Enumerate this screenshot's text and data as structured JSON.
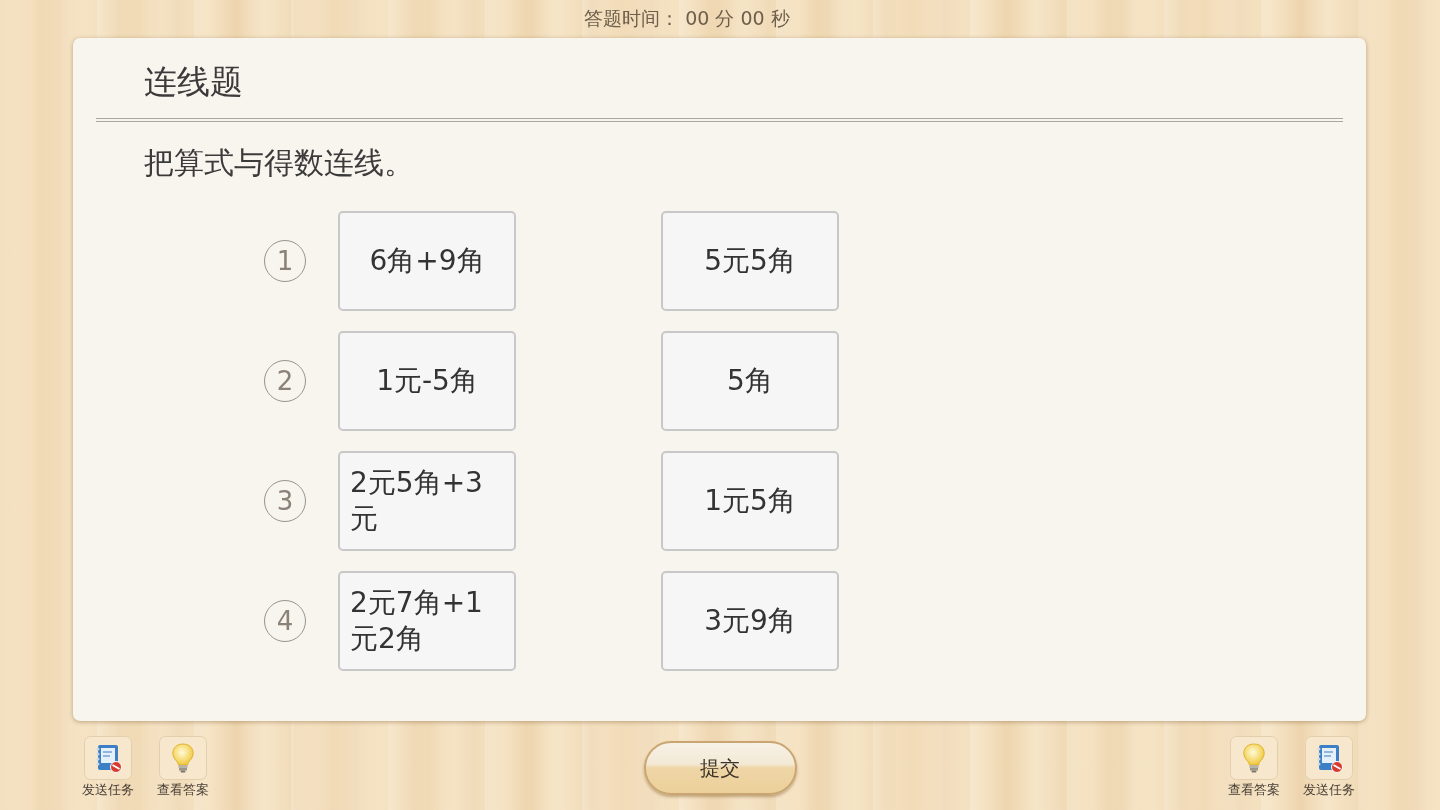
{
  "timer": {
    "text": "答题时间： 00 分 00 秒"
  },
  "question": {
    "type": "连线题",
    "instruction": "把算式与得数连线。",
    "rows": [
      {
        "number": "1",
        "left": "6角+9角",
        "right": "5元5角"
      },
      {
        "number": "2",
        "left": "1元-5角",
        "right": "5角"
      },
      {
        "number": "3",
        "left": "2元5角+3元",
        "right": "1元5角"
      },
      {
        "number": "4",
        "left": "2元7角+1元2角",
        "right": "3元9角"
      }
    ]
  },
  "toolbar_left": [
    {
      "kind": "send_task",
      "label": "发送任务"
    },
    {
      "kind": "view_answer",
      "label": "查看答案"
    }
  ],
  "submit_button": {
    "label": "提交"
  },
  "toolbar_right": [
    {
      "kind": "view_answer",
      "label": "查看答案"
    },
    {
      "kind": "send_task",
      "label": "发送任务"
    }
  ]
}
